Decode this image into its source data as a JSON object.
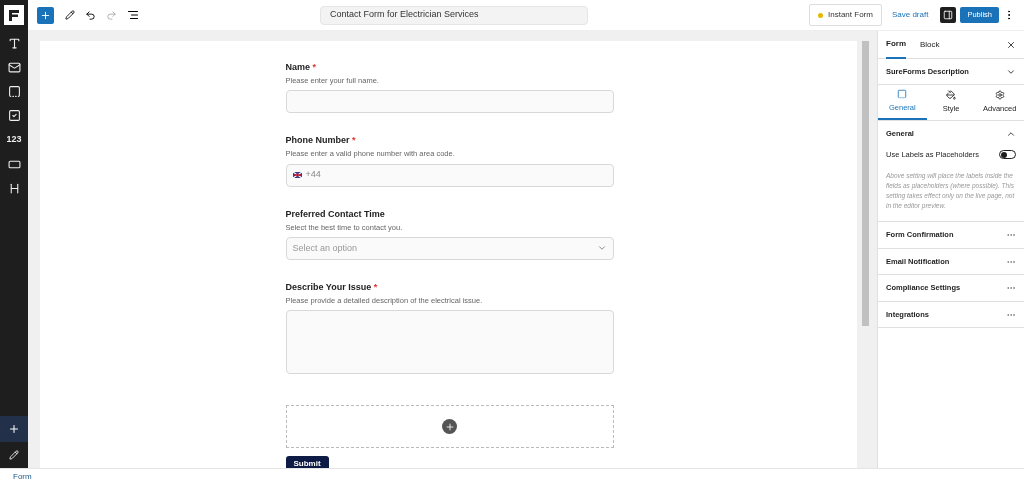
{
  "toolbar": {
    "title": "Contact Form for Electrician Services",
    "status": "Instant Form",
    "save": "Save draft",
    "publish": "Publish",
    "sidebar_open": true
  },
  "sidebar": {
    "number_block": "123"
  },
  "form": {
    "required_marker": "*",
    "fields": [
      {
        "kind": "text",
        "label": "Name",
        "required": true,
        "help": "Please enter your full name."
      },
      {
        "kind": "phone",
        "label": "Phone Number",
        "required": true,
        "help": "Please enter a valid phone number with area code.",
        "value": "+44"
      },
      {
        "kind": "select",
        "label": "Preferred Contact Time",
        "required": false,
        "help": "Select the best time to contact you.",
        "placeholder": "Select an option"
      },
      {
        "kind": "textarea",
        "label": "Describe Your Issue",
        "required": true,
        "help": "Please provide a detailed description of the electrical issue."
      }
    ],
    "submit": "Submit"
  },
  "panel": {
    "tabs": [
      {
        "label": "Form",
        "selected": true
      },
      {
        "label": "Block",
        "selected": false
      }
    ],
    "description_heading": "SureForms Description",
    "subtabs": [
      {
        "label": "General",
        "selected": true
      },
      {
        "label": "Style",
        "selected": false
      },
      {
        "label": "Advanced",
        "selected": false
      }
    ],
    "general": {
      "title": "General",
      "expanded": true,
      "toggle_label": "Use Labels as Placeholders",
      "on": false,
      "note": "Above setting will place the labels inside the fields as placeholders (where possible). This setting takes effect only on the live page, not in the editor preview."
    },
    "sections": [
      "Form Confirmation",
      "Email Notification",
      "Compliance Settings",
      "Integrations"
    ]
  },
  "status_bar": {
    "breadcrumb": "Form"
  }
}
